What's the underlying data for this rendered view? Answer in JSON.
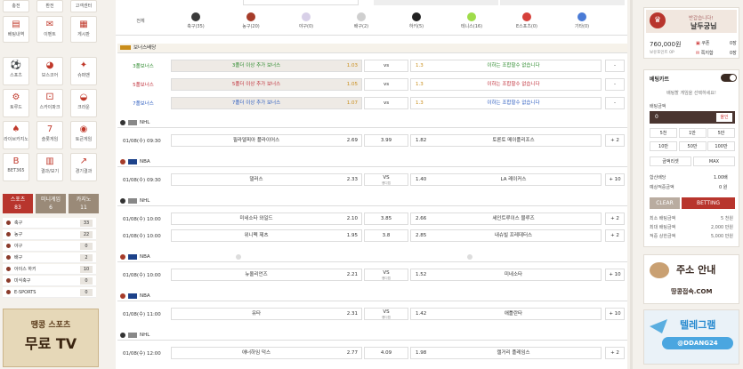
{
  "left": {
    "top_buttons": [
      "충전",
      "환전",
      "고객센터"
    ],
    "menu_row1": [
      "베팅내역",
      "이벤트",
      "게시판"
    ],
    "menu": [
      {
        "label": "스포츠",
        "icon": "soccer-icon"
      },
      {
        "label": "보스코어",
        "icon": "glasses-icon"
      },
      {
        "label": "슈퍼맨",
        "icon": "hero-icon"
      },
      {
        "label": "토루드",
        "icon": "gear-icon"
      },
      {
        "label": "스카이파크",
        "icon": "dice-icon"
      },
      {
        "label": "크라운",
        "icon": "bowl-icon"
      },
      {
        "label": "라이브카지노",
        "icon": "cards-icon"
      },
      {
        "label": "슬롯게임",
        "icon": "slot-icon"
      },
      {
        "label": "토큰게임",
        "icon": "chip-icon"
      },
      {
        "label": "BET365",
        "icon": "bet365-icon"
      },
      {
        "label": "결과/보기",
        "icon": "chart-icon"
      },
      {
        "label": "경기결과",
        "icon": "trend-icon"
      }
    ],
    "tabs": [
      {
        "label": "스포츠",
        "count": "83"
      },
      {
        "label": "미니게임",
        "count": "6"
      },
      {
        "label": "카지노",
        "count": "11"
      }
    ],
    "sports": [
      {
        "name": "축구",
        "count": "33"
      },
      {
        "name": "농구",
        "count": "22"
      },
      {
        "name": "야구",
        "count": "0"
      },
      {
        "name": "배구",
        "count": "2"
      },
      {
        "name": "아이스 하키",
        "count": "10"
      },
      {
        "name": "미식축구",
        "count": "0"
      },
      {
        "name": "E-SPORTS",
        "count": "0"
      }
    ],
    "banner": {
      "top": "땡콩 스포츠",
      "main": "무료 TV"
    }
  },
  "nav": [
    {
      "label": "전체",
      "color": "#ffffff"
    },
    {
      "label": "축구(35)",
      "color": "#3a3a3a"
    },
    {
      "label": "농구(20)",
      "color": "#a63c2a"
    },
    {
      "label": "야구(0)",
      "color": "#d8d0e8"
    },
    {
      "label": "배구(2)",
      "color": "#cfcfcf"
    },
    {
      "label": "하키(5)",
      "color": "#222222"
    },
    {
      "label": "테니스(16)",
      "color": "#9fdc4a"
    },
    {
      "label": "E스포츠(0)",
      "color": "#d6403a"
    },
    {
      "label": "기타(0)",
      "color": "#4a7bd6"
    }
  ],
  "bonus": {
    "title": "보너스배당",
    "rows": [
      {
        "name": "3폴보너스",
        "home": "3폴더 이상 추가 보너스",
        "odds": "1.03",
        "vs": "vs",
        "away_odds": "1.3",
        "away": "이하는 조합할수 없습니다",
        "more": "-",
        "color": "#2e8b2e"
      },
      {
        "name": "5폴보너스",
        "home": "5폴더 이상 추가 보너스",
        "odds": "1.05",
        "vs": "vs",
        "away_odds": "1.3",
        "away": "이하는 조합할수 없습니다",
        "more": "-",
        "color": "#c0303a"
      },
      {
        "name": "7폴보너스",
        "home": "7폴더 이상 추가 보너스",
        "odds": "1.07",
        "vs": "vs",
        "away_odds": "1.3",
        "away": "이하는 조합할수 없습니다",
        "more": "-",
        "color": "#2e5ec0"
      }
    ]
  },
  "games": [
    {
      "league": "NHL",
      "rows": [
        {
          "time": "01/08(수) 09:30",
          "home": "필라델피아 플라이어스",
          "h": "2.69",
          "d": "3.99",
          "a": "1.82",
          "away": "토론토 메이플리프스",
          "more": "+ 2"
        }
      ]
    },
    {
      "league": "NBA",
      "rows": [
        {
          "time": "01/08(수) 09:30",
          "home": "댈러스",
          "h": "2.33",
          "d": "VS",
          "dsub": "핸디캡",
          "a": "1.40",
          "away": "LA 레이커스",
          "more": "+ 10"
        }
      ]
    },
    {
      "league": "NHL",
      "rows": [
        {
          "time": "01/08(수) 10:00",
          "home": "미네소타 와일드",
          "h": "2.10",
          "d": "3.85",
          "a": "2.66",
          "away": "세인트루이스 블루즈",
          "more": "+ 2"
        },
        {
          "time": "01/08(수) 10:00",
          "home": "위니펙 제츠",
          "h": "1.95",
          "d": "3.8",
          "a": "2.85",
          "away": "내슈빌 프레데터스",
          "more": "+ 2"
        }
      ]
    },
    {
      "league": "NBA",
      "rows": [
        {
          "time": "01/08(수) 10:00",
          "home": "뉴올리언즈",
          "h": "2.21",
          "d": "VS",
          "dsub": "핸디캡",
          "a": "1.52",
          "away": "미네소타",
          "more": "+ 10"
        }
      ]
    },
    {
      "league": "NBA",
      "rows": [
        {
          "time": "01/08(수) 11:00",
          "home": "유타",
          "h": "2.31",
          "d": "VS",
          "dsub": "핸디캡",
          "a": "1.42",
          "away": "애틀란타",
          "more": "+ 10"
        }
      ]
    },
    {
      "league": "NHL",
      "rows": [
        {
          "time": "01/08(수) 12:00",
          "home": "애너하임 덕스",
          "h": "2.77",
          "d": "4.09",
          "a": "1.98",
          "away": "캘거리 플레임스",
          "more": "+ 2"
        }
      ]
    }
  ],
  "right": {
    "greeting": "반갑습니다!",
    "username": "날두궁님",
    "money": "760,000원",
    "points_label": "보유포인트 0P",
    "coupon": "쿠폰",
    "coupon_n": "0장",
    "msg": "쪽지함",
    "msg_n": "0장",
    "bet_cart": "베팅카트",
    "bet_hint": "배팅할 게임을 선택하세요!",
    "bet_amount": "배팅금액",
    "amount_val": "0",
    "all_in": "올인",
    "keys": [
      "5천",
      "1만",
      "5만",
      "10만",
      "50만",
      "100만"
    ],
    "reset": "금액리셋",
    "max": "MAX",
    "odds_label": "합산배당",
    "odds_val": "1.00배",
    "win_label": "예상적중금액",
    "win_val": "0 원",
    "clear": "CLEAR",
    "betting": "BETTING",
    "limits": [
      {
        "k": "최소 배팅금액",
        "v": "5 천원"
      },
      {
        "k": "최대 배팅금액",
        "v": "2,000 만원"
      },
      {
        "k": "적중 상한금액",
        "v": "5,000 만원"
      }
    ],
    "banner1_title": "주소 안내",
    "banner1_url": "땅콩접속.COM",
    "banner2_title": "텔레그램",
    "banner2_id": "@DDANG24"
  }
}
